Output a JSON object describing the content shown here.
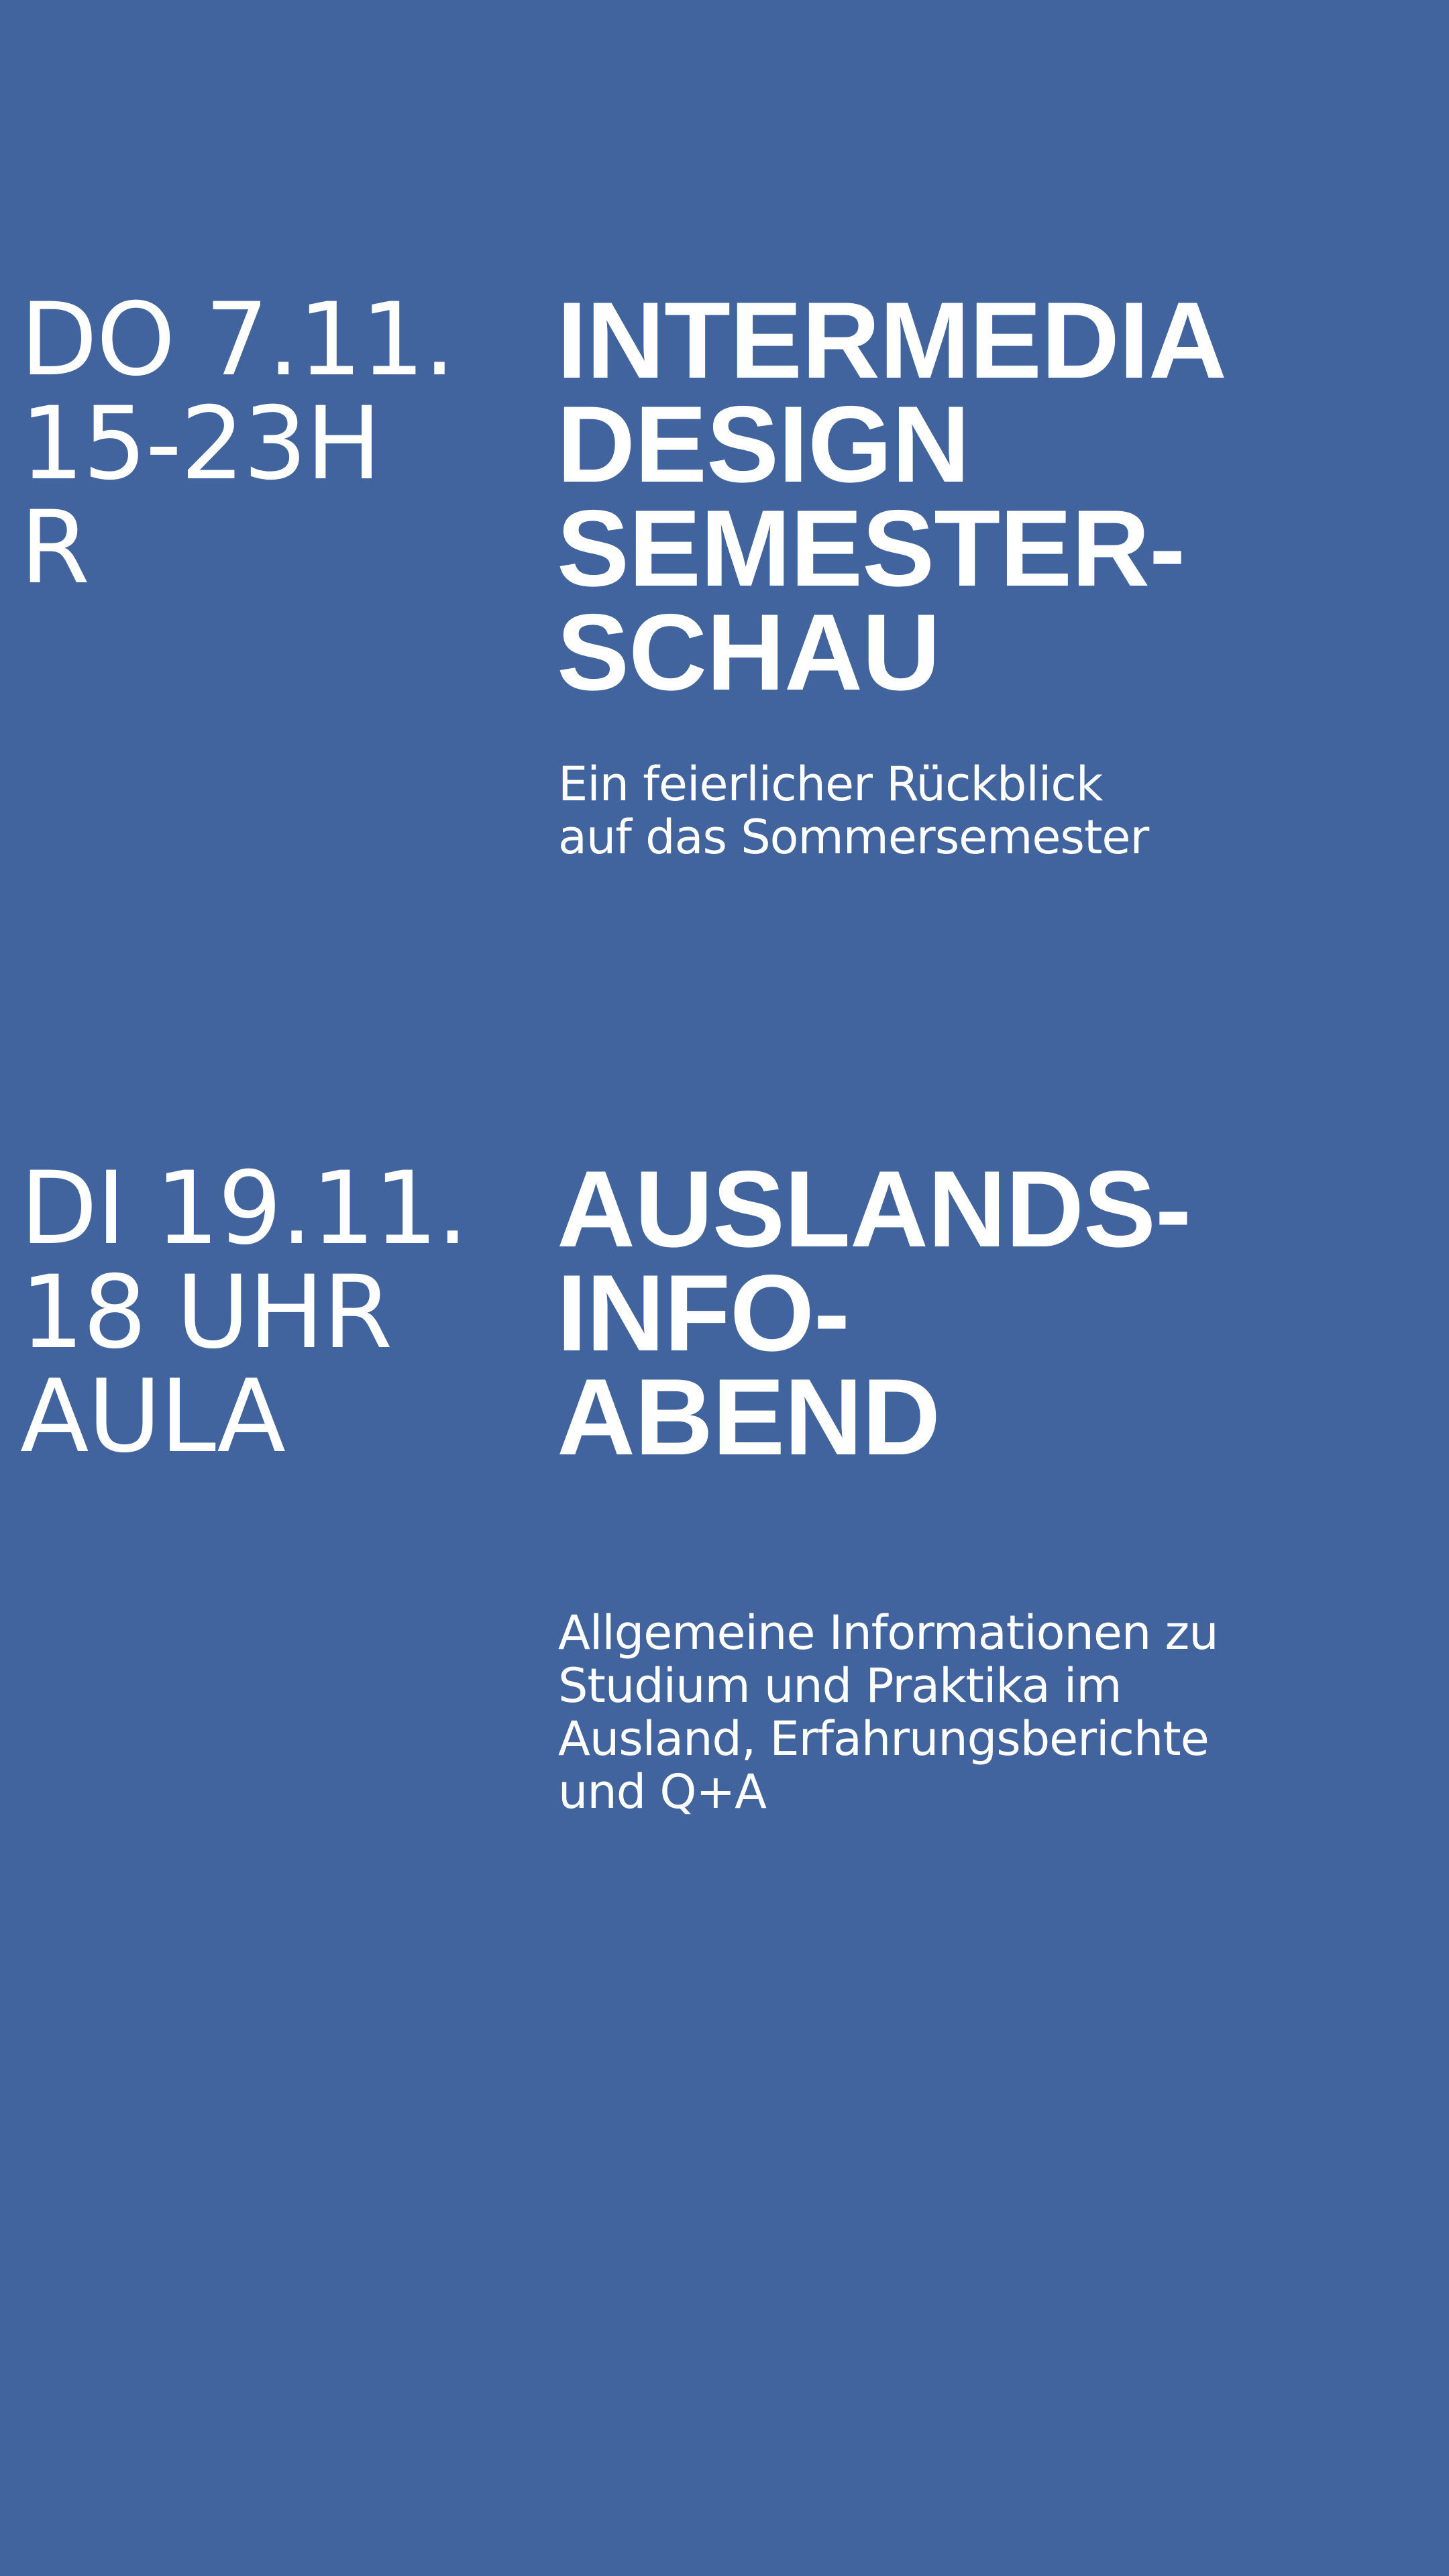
{
  "events": [
    {
      "meta": [
        "DO 7.11.",
        "15-23H",
        "R"
      ],
      "title": [
        "INTERMEDIA",
        "DESIGN",
        "SEMESTER-",
        "SCHAU"
      ],
      "description": [
        "Ein feierlicher Rückblick",
        "auf das Sommersemester"
      ]
    },
    {
      "meta": [
        "DI 19.11.",
        "18 UHR",
        "AULA"
      ],
      "title": [
        "AUSLANDS-",
        "INFO-",
        "ABEND"
      ],
      "description": [
        "Allgemeine Informationen zu",
        "Studium und Praktika im",
        "Ausland, Erfahrungsberichte",
        "und Q+A"
      ]
    }
  ],
  "colors": {
    "background": "#41639e",
    "text": "#ffffff"
  }
}
